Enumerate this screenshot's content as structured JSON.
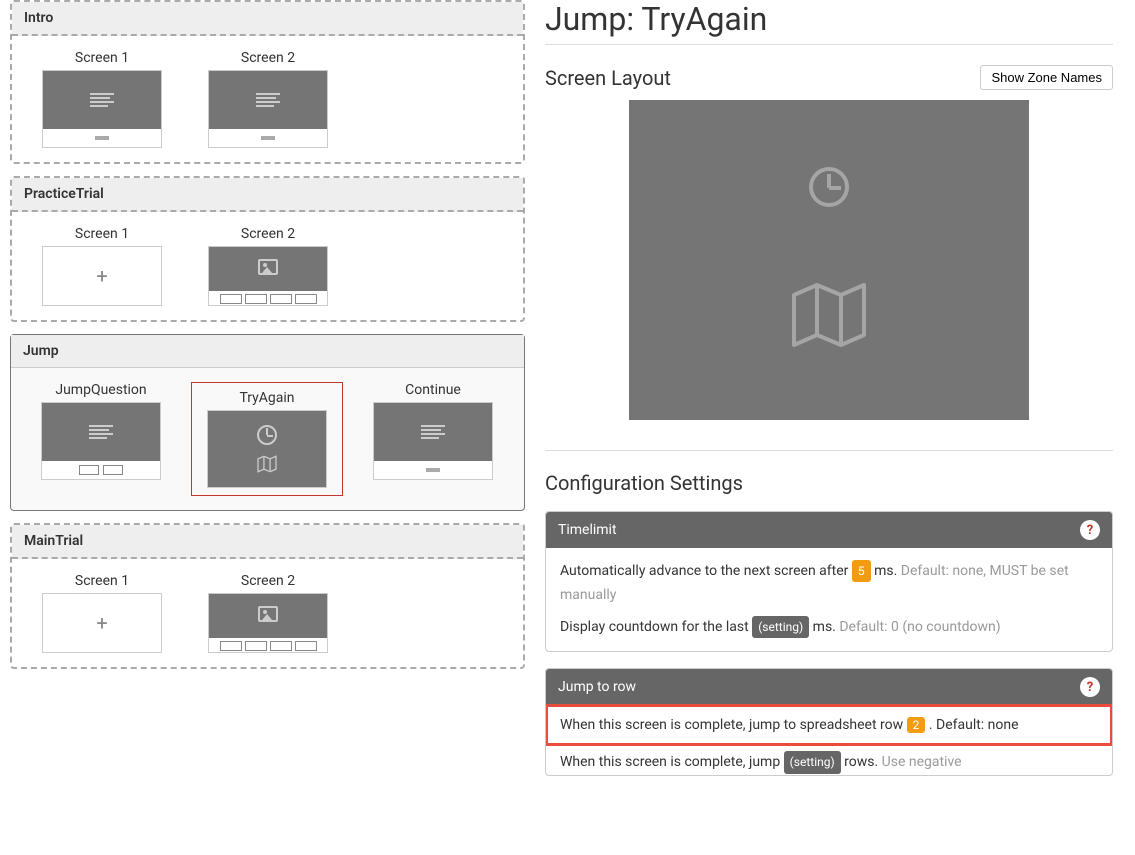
{
  "groups": [
    {
      "name": "Intro",
      "selected": false,
      "screens": [
        {
          "label": "Screen 1",
          "type": "text-dash"
        },
        {
          "label": "Screen 2",
          "type": "text-dash"
        }
      ]
    },
    {
      "name": "PracticeTrial",
      "selected": false,
      "screens": [
        {
          "label": "Screen 1",
          "type": "blank-plus"
        },
        {
          "label": "Screen 2",
          "type": "image-buttons"
        }
      ]
    },
    {
      "name": "Jump",
      "selected": true,
      "screens": [
        {
          "label": "JumpQuestion",
          "type": "text-twobtns"
        },
        {
          "label": "TryAgain",
          "type": "clock-map",
          "selected": true
        },
        {
          "label": "Continue",
          "type": "text-dash"
        }
      ]
    },
    {
      "name": "MainTrial",
      "selected": false,
      "screens": [
        {
          "label": "Screen 1",
          "type": "blank-plus"
        },
        {
          "label": "Screen 2",
          "type": "image-buttons"
        }
      ]
    }
  ],
  "page_title": "Jump: TryAgain",
  "screen_layout_title": "Screen Layout",
  "show_zone_names_btn": "Show Zone Names",
  "config_title": "Configuration Settings",
  "timelimit": {
    "header": "Timelimit",
    "line1_pre": "Automatically advance to the next screen after ",
    "line1_val": "5",
    "line1_post": " ms. ",
    "line1_default": "Default: none, MUST be set manually",
    "line2_pre": "Display countdown for the last ",
    "line2_val": "(setting)",
    "line2_post": " ms. ",
    "line2_default": "Default: 0 (no countdown)"
  },
  "jumptorow": {
    "header": "Jump to row",
    "line1_pre": "When this screen is complete, jump to spreadsheet row ",
    "line1_val": "2",
    "line1_post": " . ",
    "line1_default": "Default: none",
    "line2_pre": "When this screen is complete, jump ",
    "line2_val": "(setting)",
    "line2_post": " rows. ",
    "line2_default": "Use negative"
  }
}
